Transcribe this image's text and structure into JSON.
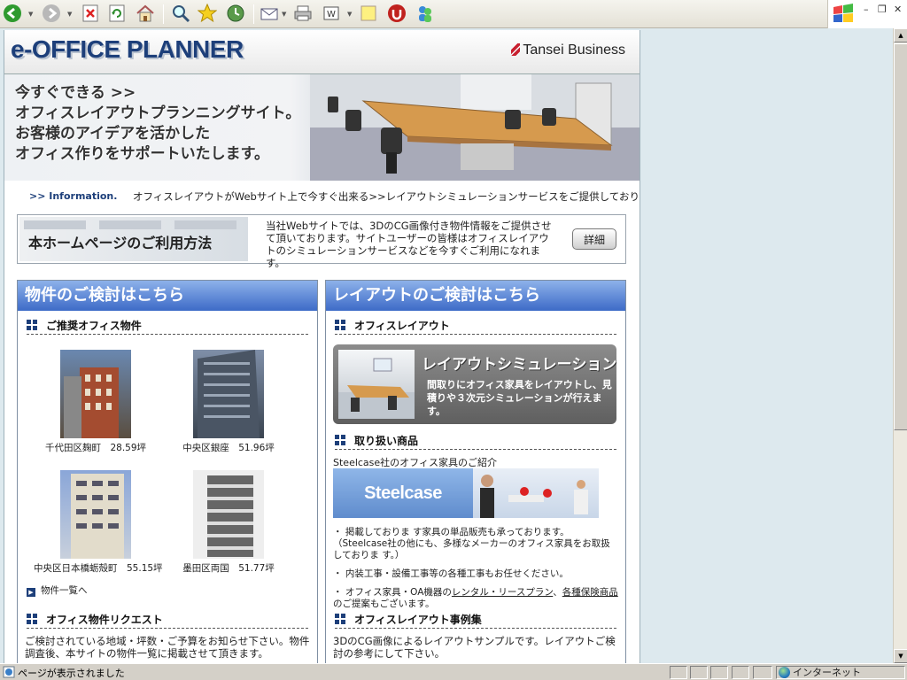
{
  "browser": {
    "status_text": "ページが表示されました",
    "zone_text": "インターネット"
  },
  "header": {
    "logo": "e-OFFICE PLANNER",
    "brand": "Tansei Business"
  },
  "hero": {
    "lines": [
      "今すぐできる >>",
      "オフィスレイアウトプランニングサイト。",
      "お客様のアイデアを活かした",
      "オフィス作りをサポートいたします。"
    ]
  },
  "info": {
    "label": ">> Information.",
    "text": "オフィスレイアウトがWebサイト上で今すぐ出来る>>レイアウトシミュレーションサービスをご提供しており"
  },
  "howto": {
    "title": "本ホームページのご利用方法",
    "description": "当社Webサイトでは、3DのCG画像付き物件情報をご提供させて頂いております。サイトユーザーの皆様はオフィスレイアウトのシミュレーションサービスなどを今すぐご利用になれます。",
    "button": "詳細"
  },
  "left": {
    "heading": "物件のご検討はこちら",
    "section1": "ご推奨オフィス物件",
    "properties": [
      {
        "caption": "千代田区麹町　28.59坪"
      },
      {
        "caption": "中央区銀座　51.96坪"
      },
      {
        "caption": "中央区日本橋蛎殻町　55.15坪"
      },
      {
        "caption": "墨田区両国　51.77坪"
      }
    ],
    "list_link": "物件一覧へ",
    "section2": "オフィス物件リクエスト",
    "request_text": "ご検討されている地域・坪数・ご予算をお知らせ下さい。物件調査後、本サイトの物件一覧に掲載させて頂きます。"
  },
  "right": {
    "heading": "レイアウトのご検討はこちら",
    "section1": "オフィスレイアウト",
    "sim_title": "レイアウトシミュレーション",
    "sim_desc": "間取りにオフィス家具をレイアウトし、見積りや３次元シミュレーションが行えます。",
    "section2": "取り扱い商品",
    "steelcase_intro": "Steelcase社のオフィス家具のご紹介",
    "steelcase_logo": "Steelcase",
    "bullet1a": "・ 掲載しておりま す家具の単品販売も承っております。",
    "bullet1b": "（Steelcase社の他にも、多様なメーカーのオフィス家具をお取扱しておりま す。）",
    "bullet2": "・ 内装工事・設備工事等の各種工事もお任せください。",
    "bullet3_pre": "・ オフィス家具・OA機器の",
    "bullet3_link1": "レンタル・リースプラン",
    "bullet3_mid": "、",
    "bullet3_link2": "各種保険商品",
    "bullet3_post": "のご提案もございます。",
    "section3": "オフィスレイアウト事例集",
    "cases_text": "3DのCG画像によるレイアウトサンプルです。レイアウトご検討の参考にして下さい。"
  },
  "colors": {
    "brand_navy": "#1d3f7a",
    "column_head": "#3d6bc7",
    "viewport_bg": "#dde9ee"
  }
}
